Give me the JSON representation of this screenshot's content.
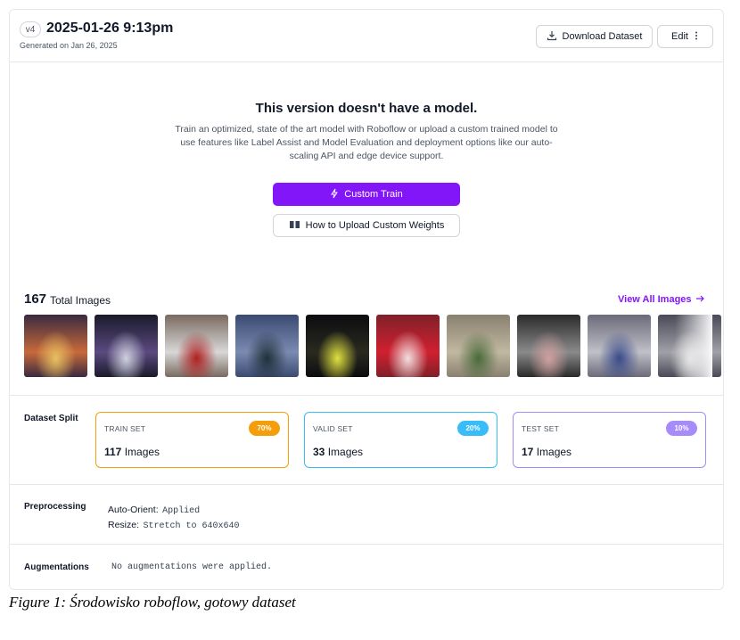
{
  "header": {
    "version_badge": "v4",
    "title": "2025-01-26 9:13pm",
    "subtitle": "Generated on Jan 26, 2025",
    "download_label": "Download Dataset",
    "edit_label": "Edit"
  },
  "no_model": {
    "title": "This version doesn't have a model.",
    "description": "Train an optimized, state of the art model with Roboflow or upload a custom trained model to use features like Label Assist and Model Evaluation and deployment options like our auto-scaling API and edge device support.",
    "train_label": "Custom Train",
    "upload_label": "How to Upload Custom Weights"
  },
  "images": {
    "count": "167",
    "count_label": "Total Images",
    "view_all_label": "View All Images",
    "thumbnails": [
      {
        "a": "#3a2a40",
        "b": "#c86a3a",
        "c": "#e8c060"
      },
      {
        "a": "#1a1a2a",
        "b": "#5a4a80",
        "c": "#d0d0e0"
      },
      {
        "a": "#7a6a60",
        "b": "#d8d8d8",
        "c": "#b02020"
      },
      {
        "a": "#3a4a70",
        "b": "#7a8ab0",
        "c": "#20303a"
      },
      {
        "a": "#0c0c10",
        "b": "#2a2a20",
        "c": "#e0e040"
      },
      {
        "a": "#802028",
        "b": "#d02030",
        "c": "#f0e0e0"
      },
      {
        "a": "#8a8070",
        "b": "#c0b8a0",
        "c": "#4a6a3a"
      },
      {
        "a": "#2a2a2a",
        "b": "#8a8a8a",
        "c": "#d0a0a0"
      },
      {
        "a": "#6a6a7a",
        "b": "#c0c0c8",
        "c": "#3a4a8a"
      },
      {
        "a": "#4a4a58",
        "b": "#a0a0a8",
        "c": "#d8d8d8"
      }
    ]
  },
  "split": {
    "label": "Dataset Split",
    "cards": [
      {
        "name": "TRAIN SET",
        "percent": "70%",
        "count": "117",
        "unit": "Images",
        "color": "#f59e0b",
        "badge": "#f59e0b"
      },
      {
        "name": "VALID SET",
        "percent": "20%",
        "count": "33",
        "unit": "Images",
        "color": "#38bdf8",
        "badge": "#38bdf8"
      },
      {
        "name": "TEST SET",
        "percent": "10%",
        "count": "17",
        "unit": "Images",
        "color": "#a78bfa",
        "badge": "#a78bfa"
      }
    ]
  },
  "preprocessing": {
    "label": "Preprocessing",
    "items": [
      {
        "key": "Auto-Orient:",
        "value": "Applied"
      },
      {
        "key": "Resize:",
        "value": "Stretch to 640x640"
      }
    ]
  },
  "augmentations": {
    "label": "Augmentations",
    "value": "No augmentations were applied."
  },
  "caption": "Figure 1: Środowisko roboflow, gotowy dataset"
}
